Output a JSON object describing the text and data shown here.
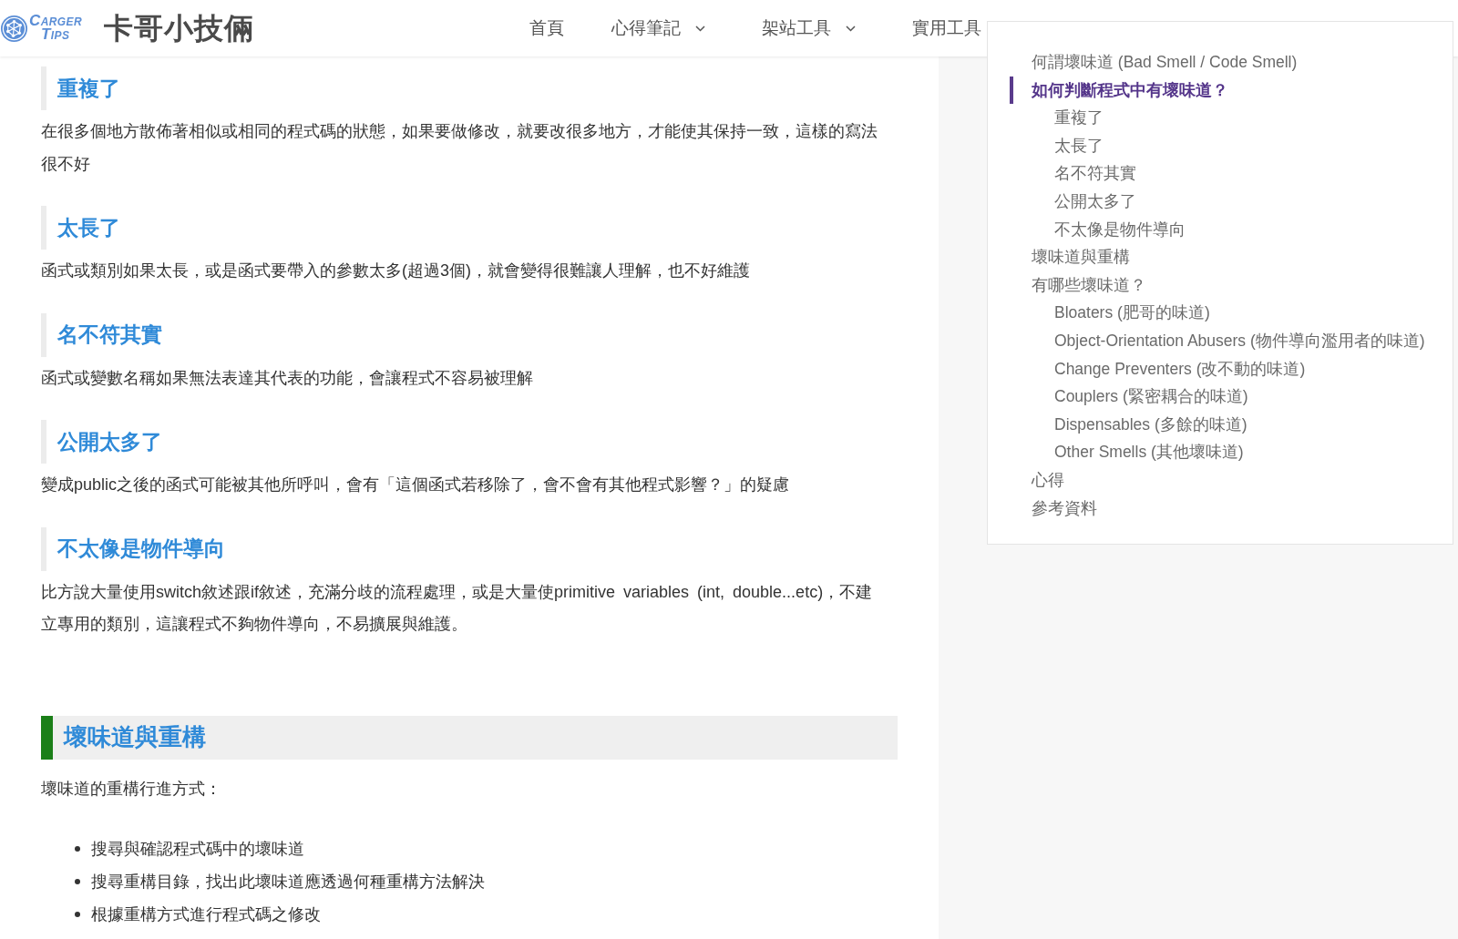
{
  "header": {
    "logo_text": [
      "CARGER",
      "TIPS"
    ],
    "site_title": "卡哥小技倆",
    "nav": [
      {
        "label": "首頁",
        "dropdown": false
      },
      {
        "label": "心得筆記",
        "dropdown": true
      },
      {
        "label": "架站工具",
        "dropdown": true
      },
      {
        "label": "實用工具",
        "dropdown": false
      }
    ]
  },
  "article": {
    "sections": [
      {
        "kind": "subsection",
        "heading": "重複了",
        "paragraphs": [
          "在很多個地方散佈著相似或相同的程式碼的狀態，如果要做修改，就要改很多地方，才能使其保持一致，這樣的寫法很不好"
        ]
      },
      {
        "kind": "subsection",
        "heading": "太長了",
        "paragraphs": [
          "函式或類別如果太長，或是函式要帶入的參數太多(超過3個)，就會變得很難讓人理解，也不好維護"
        ]
      },
      {
        "kind": "subsection",
        "heading": "名不符其實",
        "paragraphs": [
          "函式或變數名稱如果無法表達其代表的功能，會讓程式不容易被理解"
        ]
      },
      {
        "kind": "subsection",
        "heading": "公開太多了",
        "paragraphs": [
          "變成public之後的函式可能被其他所呼叫，會有「這個函式若移除了，會不會有其他程式影響？」的疑慮"
        ]
      },
      {
        "kind": "subsection",
        "heading": "不太像是物件導向",
        "paragraphs": [
          "比方說大量使用switch敘述跟if敘述，充滿分歧的流程處理，或是大量使primitive variables (int, double...etc)，不建立專用的類別，這讓程式不夠物件導向，不易擴展與維護。"
        ]
      },
      {
        "kind": "section",
        "heading": "壞味道與重構",
        "paragraphs": [
          "壞味道的重構行進方式："
        ],
        "bullets": [
          "搜尋與確認程式碼中的壞味道",
          "搜尋重構目錄，找出此壞味道應透過何種重構方法解決",
          "根據重構方式進行程式碼之修改"
        ]
      }
    ]
  },
  "toc": {
    "items": [
      {
        "label": "何謂壞味道 (Bad Smell / Code Smell)",
        "selected": false
      },
      {
        "label": "如何判斷程式中有壞味道？",
        "selected": true,
        "children": [
          {
            "label": "重複了",
            "selected": false
          },
          {
            "label": "太長了",
            "selected": false
          },
          {
            "label": "名不符其實",
            "selected": false
          },
          {
            "label": "公開太多了",
            "selected": false
          },
          {
            "label": "不太像是物件導向",
            "selected": false
          }
        ]
      },
      {
        "label": "壞味道與重構",
        "selected": false
      },
      {
        "label": "有哪些壞味道？",
        "selected": false,
        "children": [
          {
            "label": "Bloaters (肥哥的味道)",
            "selected": false
          },
          {
            "label": "Object-Orientation Abusers (物件導向濫用者的味道)",
            "selected": false
          },
          {
            "label": "Change Preventers (改不動的味道)",
            "selected": false
          },
          {
            "label": "Couplers (緊密耦合的味道)",
            "selected": false
          },
          {
            "label": "Dispensables (多餘的味道)",
            "selected": false
          },
          {
            "label": "Other Smells (其他壞味道)",
            "selected": false
          }
        ]
      },
      {
        "label": "心得",
        "selected": false
      },
      {
        "label": "參考資料",
        "selected": false
      }
    ]
  }
}
